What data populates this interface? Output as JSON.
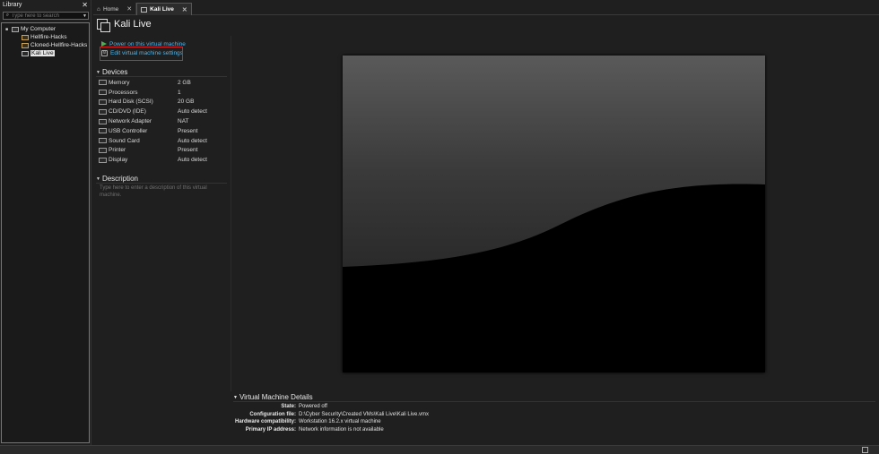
{
  "library": {
    "title": "Library",
    "close": "✕",
    "search_placeholder": "Type here to search",
    "tree": {
      "root": "My Computer",
      "items": [
        "Hellfire-Hacks",
        "Cloned-Hellfire-Hacks",
        "Kali Live"
      ],
      "selected": "Kali Live"
    }
  },
  "tabs": [
    {
      "label": "Home",
      "close": "✕"
    },
    {
      "label": "Kali Live",
      "close": "✕"
    }
  ],
  "vm": {
    "title": "Kali Live",
    "actions": {
      "power_on": "Power on this virtual machine",
      "edit_settings": "Edit virtual machine settings"
    },
    "devices_heading": "Devices",
    "devices": [
      {
        "name": "Memory",
        "value": "2 GB"
      },
      {
        "name": "Processors",
        "value": "1"
      },
      {
        "name": "Hard Disk (SCSI)",
        "value": "20 GB"
      },
      {
        "name": "CD/DVD (IDE)",
        "value": "Auto detect"
      },
      {
        "name": "Network Adapter",
        "value": "NAT"
      },
      {
        "name": "USB Controller",
        "value": "Present"
      },
      {
        "name": "Sound Card",
        "value": "Auto detect"
      },
      {
        "name": "Printer",
        "value": "Present"
      },
      {
        "name": "Display",
        "value": "Auto detect"
      }
    ],
    "description_heading": "Description",
    "description_placeholder": "Type here to enter a description of this virtual machine.",
    "details_heading": "Virtual Machine Details",
    "details": [
      {
        "key": "State:",
        "value": "Powered off"
      },
      {
        "key": "Configuration file:",
        "value": "D:\\Cyber Security\\Created VMs\\Kali Live\\Kali Live.vmx"
      },
      {
        "key": "Hardware compatibility:",
        "value": "Workstation 16.2.x virtual machine"
      },
      {
        "key": "Primary IP address:",
        "value": "Network information is not available"
      }
    ]
  },
  "colors": {
    "link": "#4fb4e8",
    "highlight": "#e02020",
    "power": "#4caf50"
  },
  "icons": [
    "search-icon",
    "chevron-down-icon",
    "computer-icon",
    "vm-icon",
    "home-icon",
    "play-icon",
    "settings-icon",
    "collapse-triangle-icon"
  ]
}
